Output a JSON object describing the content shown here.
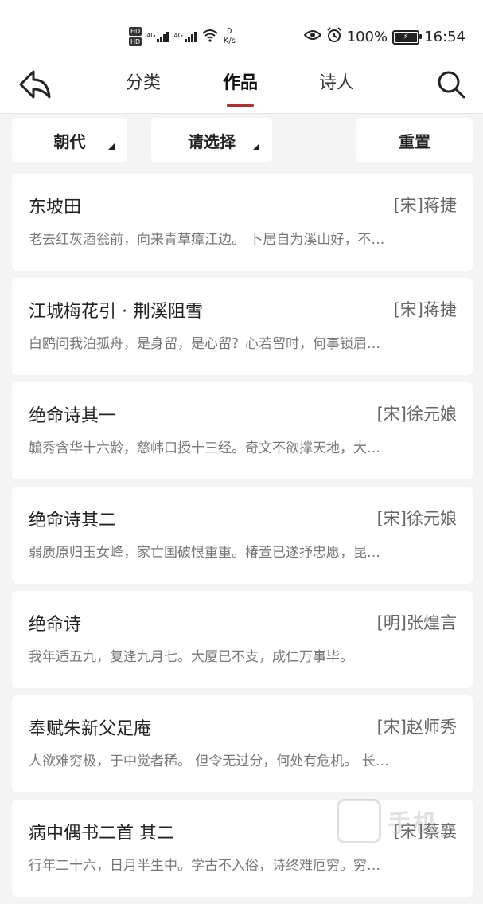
{
  "status_bar": {
    "hd1": "HD",
    "hd2": "HD",
    "net1": "4G",
    "net2": "4G",
    "speed_value": "0",
    "speed_unit": "K/s",
    "battery": "100%",
    "time": "16:54"
  },
  "nav": {
    "tabs": [
      {
        "label": "分类"
      },
      {
        "label": "作品"
      },
      {
        "label": "诗人"
      }
    ],
    "active_tab": 1
  },
  "filters": {
    "dynasty": "朝代",
    "select": "请选择",
    "reset": "重置"
  },
  "poems": [
    {
      "title": "东坡田",
      "author": "[宋]蒋捷",
      "excerpt": "老去红灰酒瓮前，向来青草瘴江边。 卜居自为溪山好，不…"
    },
    {
      "title": "江城梅花引 · 荆溪阻雪",
      "author": "[宋]蒋捷",
      "excerpt": "白鸥问我泊孤舟，是身留，是心留？心若留时，何事锁眉…"
    },
    {
      "title": "绝命诗其一",
      "author": "[宋]徐元娘",
      "excerpt": "毓秀含华十六龄，慈帏口授十三经。奇文不欲撑天地，大…"
    },
    {
      "title": "绝命诗其二",
      "author": "[宋]徐元娘",
      "excerpt": "弱质原归玉女峰，家亡国破恨重重。椿萱已遂抒忠愿，昆…"
    },
    {
      "title": "绝命诗",
      "author": "[明]张煌言",
      "excerpt": "我年适五九，复逢九月七。大厦已不支，成仁万事毕。"
    },
    {
      "title": "奉赋朱新父足庵",
      "author": "[宋]赵师秀",
      "excerpt": "人欲难穷极，于中觉者稀。 但令无过分，何处有危机。 长…"
    },
    {
      "title": "病中偶书二首 其二",
      "author": "[宋]蔡襄",
      "excerpt": "行年二十六，日月半生中。学古不入俗，诗终难厄穷。穷…"
    }
  ],
  "watermark": "手机"
}
